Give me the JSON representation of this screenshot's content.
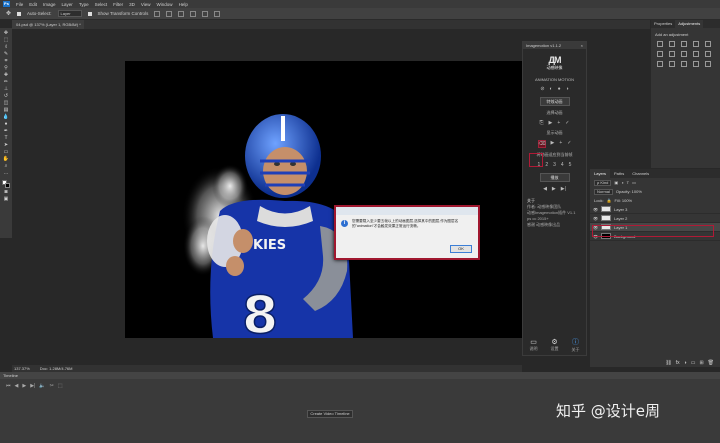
{
  "menubar": {
    "logo": "Ps",
    "items": [
      "File",
      "Edit",
      "Image",
      "Layer",
      "Type",
      "Select",
      "Filter",
      "3D",
      "View",
      "Window",
      "Help"
    ]
  },
  "optionsbar": {
    "auto_select": "Auto-Select:",
    "target": "Layer",
    "show_transform": "Show Transform Controls"
  },
  "document_tab": {
    "title": "04.psd @ 137% (Layer 1, RGB/8#) *"
  },
  "statusbar": {
    "zoom": "137.37%",
    "doc": "Doc: 1.28M/4.76M"
  },
  "timeline": {
    "title": "Timeline",
    "controls": [
      "⏮",
      "◀",
      "▶",
      "▶|",
      "🔈",
      "✂",
      "⬚"
    ],
    "create_button": "Create Video Timeline"
  },
  "plugin": {
    "title": "Imagemotion v1.1.2",
    "brand_mark": "ДМ",
    "brand_name": "动感映像",
    "subtitle": "ANIMATION MOTION",
    "section1_tools": [
      "⊘",
      "◐",
      "●",
      "◑"
    ],
    "button_special": "特效动画",
    "label_select_style": "选择动画",
    "row_play": [
      "⎘",
      "▶",
      "+",
      "✓"
    ],
    "label_show_anim": "显示动画",
    "row_anim": [
      "⌫",
      "▶",
      "+",
      "✓"
    ],
    "label_frames": "将动画适应到当前帧",
    "row_frames": [
      "1",
      "2",
      "3",
      "4",
      "5"
    ],
    "button_play": "播放",
    "row_transport": [
      "◀",
      "▶",
      "▶|"
    ],
    "about_title": "关于",
    "about_lines": [
      "作者: 动感映像团队",
      "动感Imagemotion插件 V1.1",
      "ps cc 2015+",
      "感谢    动感映像出品"
    ],
    "footer": [
      {
        "icon": "▭",
        "label": "说明"
      },
      {
        "icon": "⚙",
        "label": "设置"
      },
      {
        "icon": "ⓘ",
        "label": "关于"
      }
    ]
  },
  "right_top": {
    "tabs": [
      "Properties",
      "Adjustments"
    ],
    "header": "Add an adjustment"
  },
  "layers": {
    "tabs": [
      "Layers",
      "Paths",
      "Channels"
    ],
    "kind": "ρ Kind",
    "blend": "Normal",
    "opacity": "Opacity: 100%",
    "lock": "Lock:",
    "fill": "Fill: 100%",
    "rows": [
      {
        "name": "Layer 3",
        "dark": false,
        "selected": false
      },
      {
        "name": "Layer 2",
        "dark": false,
        "selected": false
      },
      {
        "name": "Layer 1",
        "dark": false,
        "selected": true
      },
      {
        "name": "Background",
        "dark": true,
        "selected": false
      }
    ],
    "footer_icons": [
      "⛓",
      "fx",
      "◑",
      "▭",
      "⊞",
      "🗑"
    ]
  },
  "dialog": {
    "icon": "i",
    "message": "您需要载入至少要五帧以上的动画图层,选择其中的图层,作为图层名的\"animation\"才会触发效果正常运行流畅。",
    "ok": "OK"
  },
  "watermark": "知乎 @设计e周"
}
